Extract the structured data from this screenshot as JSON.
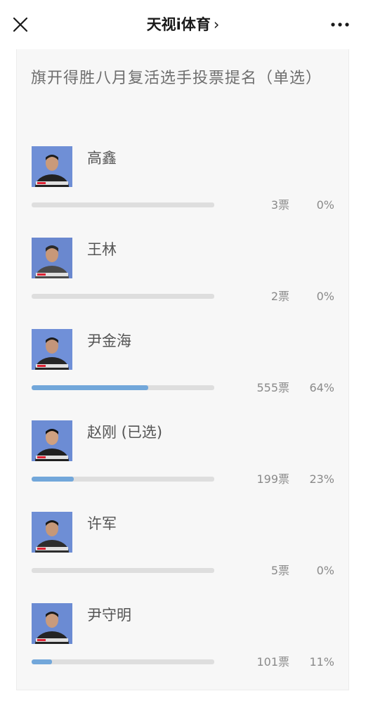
{
  "header": {
    "title": "天视i体育",
    "chevron": "›",
    "close_icon": "close-icon",
    "more_icon": "more-dots-icon"
  },
  "poll": {
    "question": "旗开得胜八月复活选手投票提名（单选）",
    "bar_color": "#72a7da",
    "track_color": "#dedede",
    "options": [
      {
        "name": "高鑫",
        "votes": "3票",
        "percent": "0%",
        "fill": 0.0
      },
      {
        "name": "王林",
        "votes": "2票",
        "percent": "0%",
        "fill": 0.0
      },
      {
        "name": "尹金海",
        "votes": "555票",
        "percent": "64%",
        "fill": 0.64
      },
      {
        "name": "赵刚 (已选)",
        "votes": "199票",
        "percent": "23%",
        "fill": 0.23
      },
      {
        "name": "许军",
        "votes": "5票",
        "percent": "0%",
        "fill": 0.0
      },
      {
        "name": "尹守明",
        "votes": "101票",
        "percent": "11%",
        "fill": 0.11
      }
    ]
  }
}
